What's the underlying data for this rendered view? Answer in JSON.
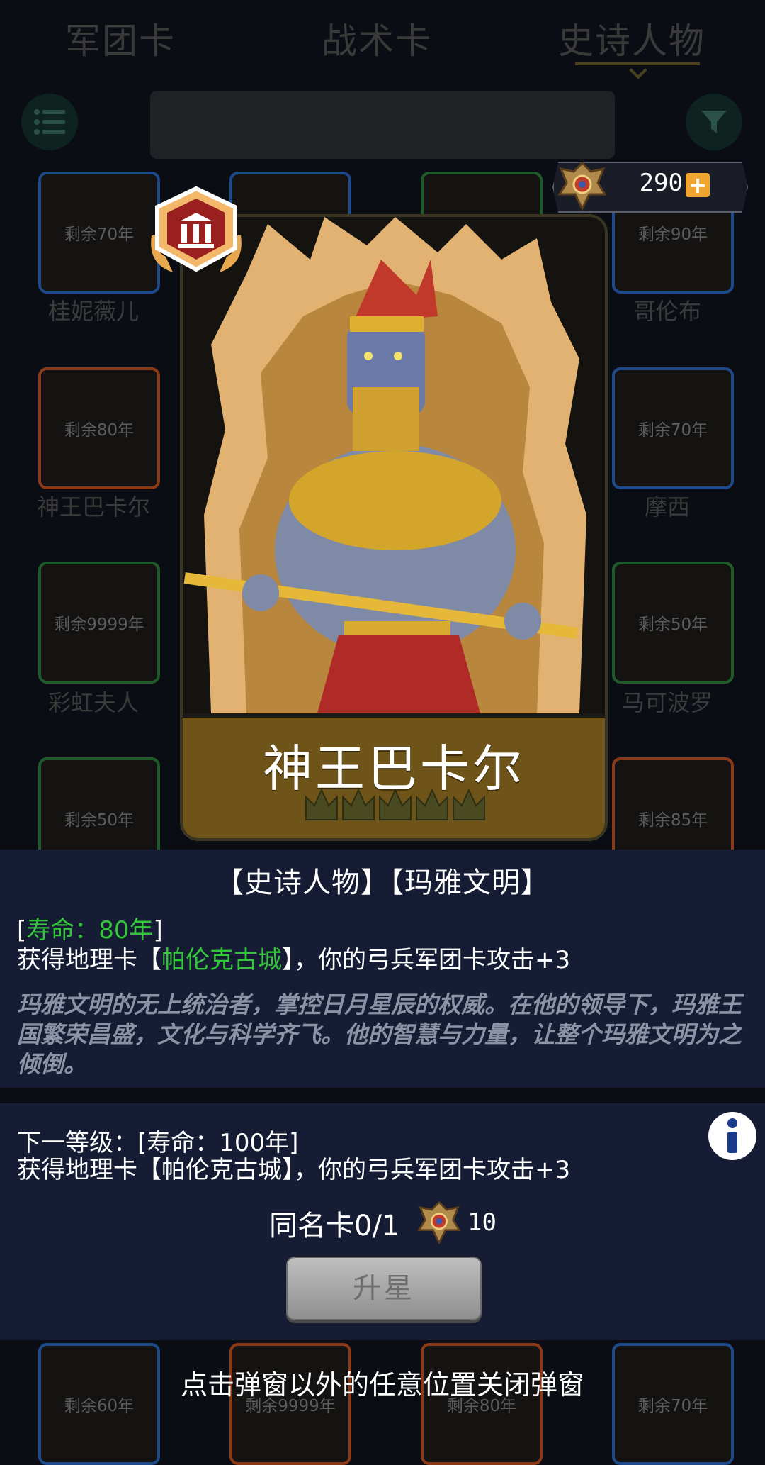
{
  "tabs": [
    {
      "label": "军团卡"
    },
    {
      "label": "战术卡"
    },
    {
      "label": "史诗人物"
    }
  ],
  "background_cards": [
    {
      "remaining": "剩余70年",
      "name": "桂妮薇儿",
      "border": "#1e4a8a"
    },
    {
      "remaining": "",
      "name": "",
      "border": "#1e4a8a"
    },
    {
      "remaining": "",
      "name": "",
      "border": "#1e5a2a"
    },
    {
      "remaining": "剩余90年",
      "name": "哥伦布",
      "border": "#1e4a8a"
    },
    {
      "remaining": "剩余80年",
      "name": "神王巴卡尔",
      "border": "#8a3a18"
    },
    {
      "remaining": "剩余70年",
      "name": "摩西",
      "border": "#1e4a8a"
    },
    {
      "remaining": "剩余9999年",
      "name": "彩虹夫人",
      "border": "#1e5a2a"
    },
    {
      "remaining": "剩余50年",
      "name": "马可波罗",
      "border": "#1e5a2a"
    },
    {
      "remaining": "剩余50年",
      "name": "",
      "border": "#1e5a2a"
    },
    {
      "remaining": "剩余85年",
      "name": "",
      "border": "#8a3a18"
    },
    {
      "remaining": "剩余60年",
      "name": "",
      "border": "#1e4a8a"
    },
    {
      "remaining": "剩余9999年",
      "name": "",
      "border": "#8a3a18"
    },
    {
      "remaining": "剩余80年",
      "name": "",
      "border": "#8a3a18"
    },
    {
      "remaining": "剩余70年",
      "name": "",
      "border": "#1e4a8a"
    }
  ],
  "currency": {
    "value": "290",
    "plus": "+"
  },
  "featured": {
    "name": "神王巴卡尔",
    "crown_count": 5
  },
  "info": {
    "tags": "【史诗人物】【玛雅文明】",
    "lifespan_open": "[",
    "lifespan": "寿命：80年",
    "lifespan_close": "]",
    "effect_prefix": "获得地理卡【",
    "effect_city": "帕伦克古城",
    "effect_suffix": "】，你的弓兵军团卡攻击+3",
    "description": "玛雅文明的无上统治者，掌控日月星辰的权威。在他的领导下，玛雅王国繁荣昌盛，文化与科学齐飞。他的智慧与力量，让整个玛雅文明为之倾倒。"
  },
  "next_level": {
    "title": "下一等级：[寿命：100年]",
    "effect": "获得地理卡【帕伦克古城】，你的弓兵军团卡攻击+3",
    "same_card": "同名卡0/1",
    "cost": "10",
    "upgrade_label": "升星"
  },
  "close_hint": "点击弹窗以外的任意位置关闭弹窗",
  "colors": {
    "accent_gold": "#f0a530",
    "effect_green": "#34c63a",
    "panel": "#151c33"
  }
}
